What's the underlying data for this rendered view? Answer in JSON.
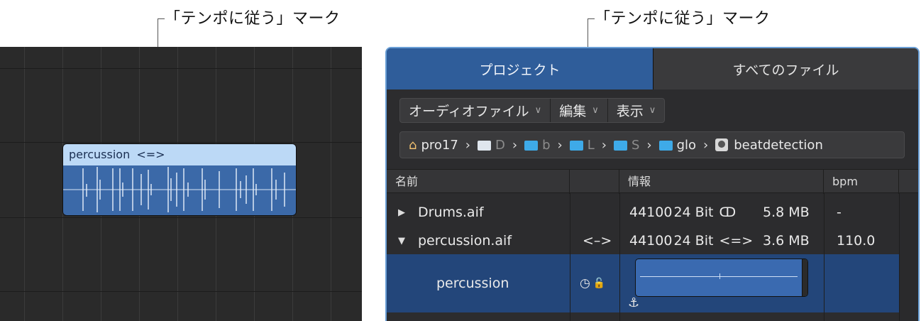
{
  "callouts": {
    "left": "「テンポに従う」マーク",
    "right": "「テンポに従う」マーク"
  },
  "region": {
    "name": "percussion",
    "follow_tempo_icon": "<=>"
  },
  "browser": {
    "tabs": [
      {
        "label": "プロジェクト",
        "active": true
      },
      {
        "label": "すべてのファイル",
        "active": false
      }
    ],
    "menus": [
      {
        "label": "オーディオファイル"
      },
      {
        "label": "編集"
      },
      {
        "label": "表示"
      }
    ],
    "path": [
      {
        "label": "pro17",
        "icon": "home-icon"
      },
      {
        "label": "D",
        "icon": "folder-icon"
      },
      {
        "label": "b",
        "icon": "folder-icon"
      },
      {
        "label": "L",
        "icon": "folder-icon"
      },
      {
        "label": "S",
        "icon": "folder-icon"
      },
      {
        "label": "glo",
        "icon": "folder-icon"
      },
      {
        "label": "beatdetection",
        "icon": "project-icon"
      }
    ],
    "columns": {
      "name": "名前",
      "info": "情報",
      "bpm": "bpm"
    },
    "rows": [
      {
        "name": "Drums.aif",
        "flag": "",
        "rate": "44100",
        "bits": "24 Bit",
        "channel_icon": "ↀ",
        "size": "5.8 MB",
        "bpm": "-",
        "expanded": false
      },
      {
        "name": "percussion.aif",
        "flag": "<–>",
        "rate": "44100",
        "bits": "24 Bit",
        "channel_icon": "<=>",
        "size": "3.6 MB",
        "bpm": "110.0",
        "expanded": true
      }
    ],
    "subrow": {
      "name": "percussion",
      "clock_icon": "◷",
      "lock_icon": "🔓",
      "anchor_icon": "⚓"
    }
  },
  "colors": {
    "accent": "#2f5d9a",
    "selection": "#23467a",
    "region_header": "#bcd9f6",
    "region_body": "#3b69a8"
  }
}
